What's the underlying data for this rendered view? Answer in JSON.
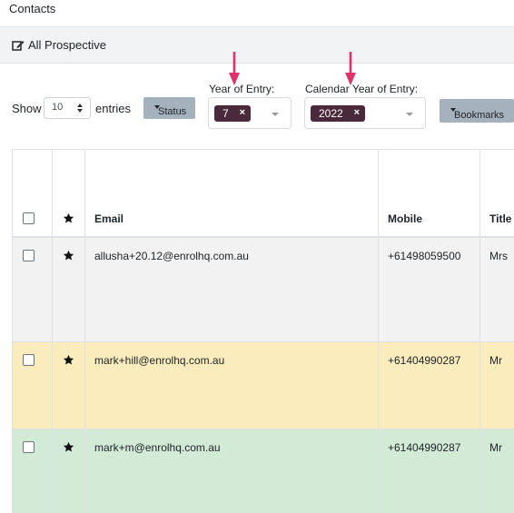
{
  "header": {
    "title": "Contacts"
  },
  "view": {
    "icon": "edit-icon",
    "label": "All Prospective"
  },
  "controls": {
    "show_label": "Show",
    "entries_value": "10",
    "entries_label": "entries",
    "status_button": "Status",
    "bookmarks_button": "Bookmarks"
  },
  "filters": {
    "year_of_entry": {
      "label": "Year of Entry:",
      "selected": "7"
    },
    "calendar_year": {
      "label": "Calendar Year of Entry:",
      "selected": "2022"
    },
    "remove_glyph": "×"
  },
  "table": {
    "columns": [
      "Email",
      "Mobile",
      "Title"
    ],
    "rows": [
      {
        "email": "allusha+20.12@enrolhq.com.au",
        "mobile": "+61498059500",
        "title": "Mrs",
        "highlight": "#f2f2f2"
      },
      {
        "email": "mark+hill@enrolhq.com.au",
        "mobile": "+61404990287",
        "title": "Mr",
        "highlight": "#fbecbd"
      },
      {
        "email": "mark+m@enrolhq.com.au",
        "mobile": "+61404990287",
        "title": "Mr",
        "highlight": "#d3ead7"
      }
    ]
  },
  "colors": {
    "tag": "#4a2a3a",
    "annotation_arrow": "#e0316a",
    "button_gray": "#a5b1bd"
  }
}
